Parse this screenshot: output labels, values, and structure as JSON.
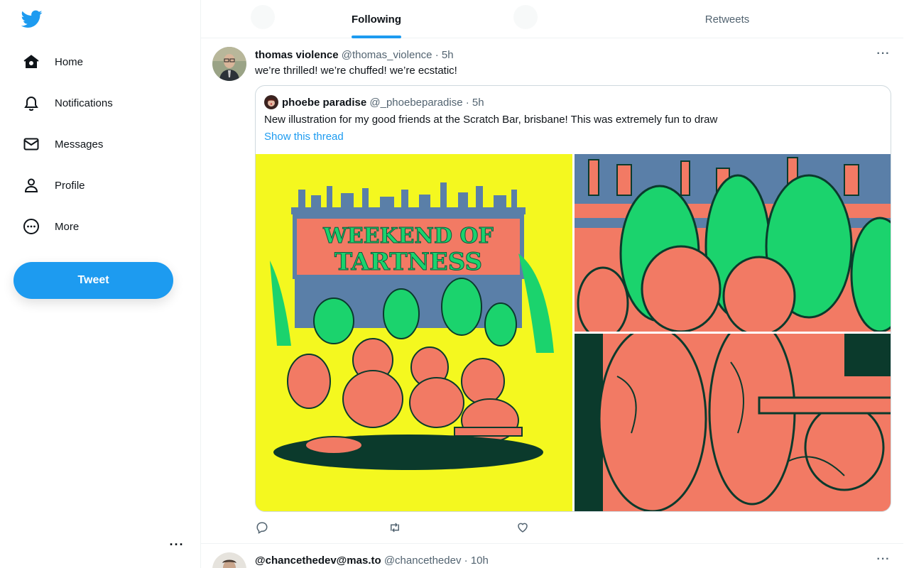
{
  "colors": {
    "brand": "#1d9bf0",
    "text": "#0f1419",
    "muted": "#536471",
    "border": "#eff3f4"
  },
  "sidebar": {
    "logo": "twitter-bird-icon",
    "items": [
      {
        "label": "Home",
        "icon": "home-icon"
      },
      {
        "label": "Notifications",
        "icon": "bell-icon"
      },
      {
        "label": "Messages",
        "icon": "envelope-icon"
      },
      {
        "label": "Profile",
        "icon": "person-icon"
      },
      {
        "label": "More",
        "icon": "more-circle-icon"
      }
    ],
    "tweet_button": "Tweet",
    "more_menu": "···"
  },
  "tabs": [
    {
      "label": "Following",
      "active": true
    },
    {
      "label": "Retweets",
      "active": false
    }
  ],
  "tweets": [
    {
      "name": "thomas violence",
      "handle": "@thomas_violence",
      "sep": "·",
      "time": "5h",
      "text": "we’re thrilled! we’re chuffed! we’re ecstatic!",
      "more": "···",
      "quote": {
        "name": "phoebe paradise",
        "handle": "@_phoebeparadise",
        "sep": "·",
        "time": "5h",
        "text": "New illustration for my good friends at the Scratch Bar, brisbane! This was extremely fun to draw",
        "link": "Show this thread",
        "poster_title_1": "WEEKEND OF",
        "poster_title_2": "TARTNESS"
      },
      "actions": [
        "reply-icon",
        "retweet-icon",
        "like-icon"
      ]
    },
    {
      "name": "@chancethedev@mas.to",
      "handle": "@chancethedev",
      "sep": "·",
      "time": "10h",
      "more": "···"
    }
  ]
}
